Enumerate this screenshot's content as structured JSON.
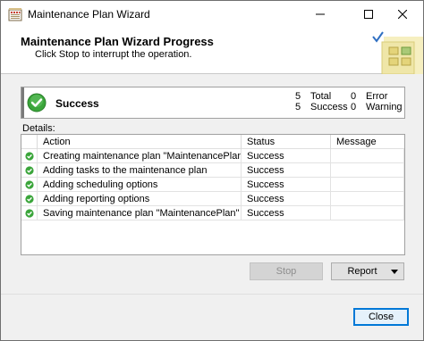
{
  "window": {
    "title": "Maintenance Plan Wizard",
    "controls": {
      "minimize": "minimize-icon",
      "maximize": "maximize-icon",
      "close": "close-icon"
    }
  },
  "header": {
    "title": "Maintenance Plan Wizard Progress",
    "subtitle": "Click Stop to interrupt the operation."
  },
  "summary": {
    "status": "Success",
    "total_count": "5",
    "total_label": "Total",
    "success_count": "5",
    "success_label": "Success",
    "error_count": "0",
    "error_label": "Error",
    "warning_count": "0",
    "warning_label": "Warning"
  },
  "details": {
    "label": "Details:",
    "columns": [
      "Action",
      "Status",
      "Message"
    ],
    "rows": [
      {
        "action": "Creating maintenance plan \"MaintenancePlan\"",
        "status": "Success",
        "message": ""
      },
      {
        "action": "Adding tasks to the maintenance plan",
        "status": "Success",
        "message": ""
      },
      {
        "action": "Adding scheduling options",
        "status": "Success",
        "message": ""
      },
      {
        "action": "Adding reporting options",
        "status": "Success",
        "message": ""
      },
      {
        "action": "Saving maintenance plan \"MaintenancePlan\"",
        "status": "Success",
        "message": ""
      }
    ]
  },
  "buttons": {
    "stop": "Stop",
    "report": "Report",
    "close": "Close"
  },
  "colors": {
    "success_green": "#3aa53a",
    "accent_blue": "#0078d7"
  }
}
